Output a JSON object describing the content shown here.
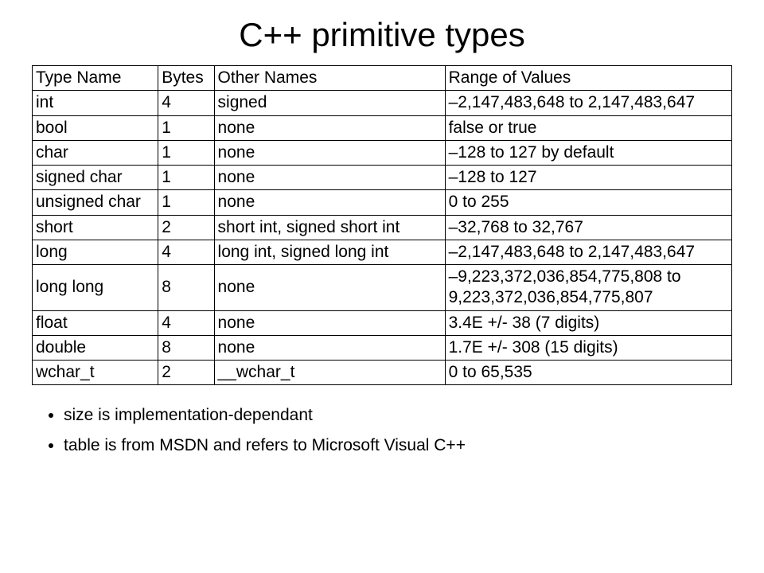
{
  "title": "C++ primitive types",
  "columns": [
    "Type Name",
    "Bytes",
    "Other Names",
    "Range of Values"
  ],
  "rows": [
    {
      "type": "int",
      "bytes": "4",
      "other": "signed",
      "range": "–2,147,483,648 to 2,147,483,647"
    },
    {
      "type": "bool",
      "bytes": "1",
      "other": "none",
      "range": "false or true"
    },
    {
      "type": "char",
      "bytes": "1",
      "other": "none",
      "range": "–128 to 127 by default"
    },
    {
      "type": "signed char",
      "bytes": "1",
      "other": "none",
      "range": "–128 to 127"
    },
    {
      "type": "unsigned char",
      "bytes": "1",
      "other": "none",
      "range": "0 to 255"
    },
    {
      "type": "short",
      "bytes": "2",
      "other": "short int, signed short int",
      "range": "–32,768 to 32,767"
    },
    {
      "type": "long",
      "bytes": "4",
      "other": "long int, signed long int",
      "range": "–2,147,483,648 to 2,147,483,647"
    },
    {
      "type": "long long",
      "bytes": "8",
      "other": "none",
      "range": "–9,223,372,036,854,775,808 to 9,223,372,036,854,775,807"
    },
    {
      "type": "float",
      "bytes": "4",
      "other": "none",
      "range": "3.4E +/- 38 (7 digits)"
    },
    {
      "type": "double",
      "bytes": "8",
      "other": "none",
      "range": "1.7E +/- 308 (15 digits)"
    },
    {
      "type": "wchar_t",
      "bytes": "2",
      "other": "__wchar_t",
      "range": "0 to 65,535"
    }
  ],
  "bullets": [
    "size is implementation-dependant",
    "table is from MSDN and refers to Microsoft Visual C++"
  ]
}
